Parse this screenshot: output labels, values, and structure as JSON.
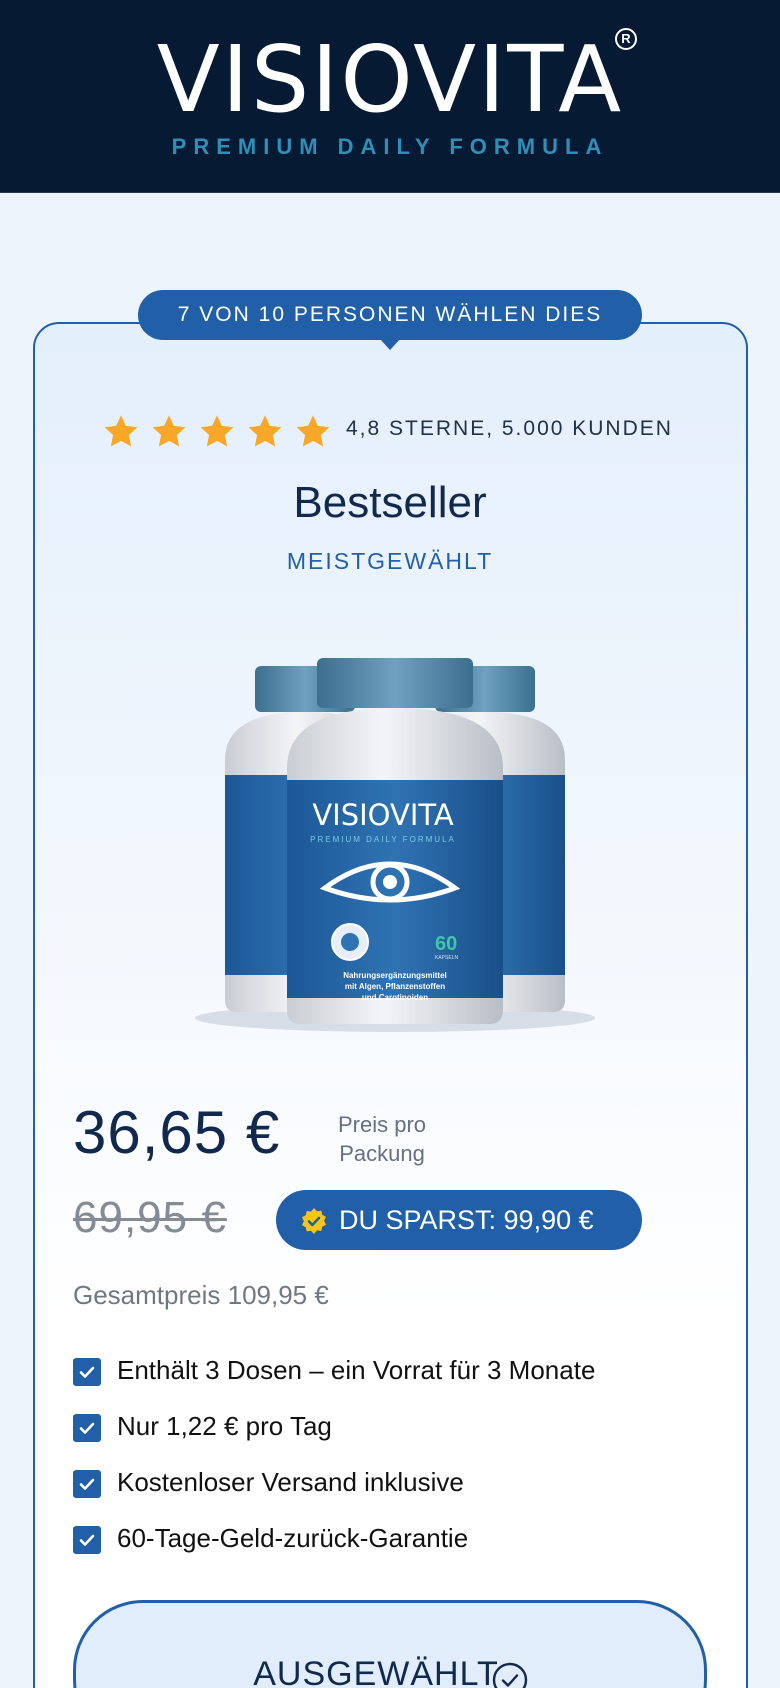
{
  "header": {
    "brand": "VISIOVITA",
    "registered_mark": "R",
    "tagline": "PREMIUM DAILY FORMULA"
  },
  "offer": {
    "badge": "7 VON 10 PERSONEN WÄHLEN DIES",
    "rating": {
      "stars": 5,
      "text": "4,8 STERNE, 5.000 KUNDEN"
    },
    "title": "Bestseller",
    "subtitle": "MEISTGEWÄHLT",
    "product_image": {
      "label": "VISIOVITA",
      "tagline": "PREMIUM DAILY FORMULA",
      "count": "60",
      "count_label": "KAPSELN",
      "description_line1": "Nahrungsergänzungsmittel",
      "description_line2": "mit Algen, Pflanzenstoffen",
      "description_line3": "und Carotinoiden"
    },
    "price": "36,65 €",
    "price_unit_line1": "Preis pro",
    "price_unit_line2": "Packung",
    "old_price": "69,95 €",
    "savings": "DU SPARST: 99,90 €",
    "total": "Gesamtpreis 109,95 €",
    "features": [
      "Enthält 3 Dosen – ein Vorrat für 3 Monate",
      "Nur 1,22 € pro Tag",
      "Kostenloser Versand inklusive",
      "60-Tage-Geld-zurück-Garantie"
    ],
    "select_label": "AUSGEWÄHLT"
  },
  "colors": {
    "header_bg": "#061a33",
    "accent": "#2160a8",
    "tagline": "#2e8fb8",
    "star": "#f9a825",
    "badge_gold": "#f5c518"
  }
}
